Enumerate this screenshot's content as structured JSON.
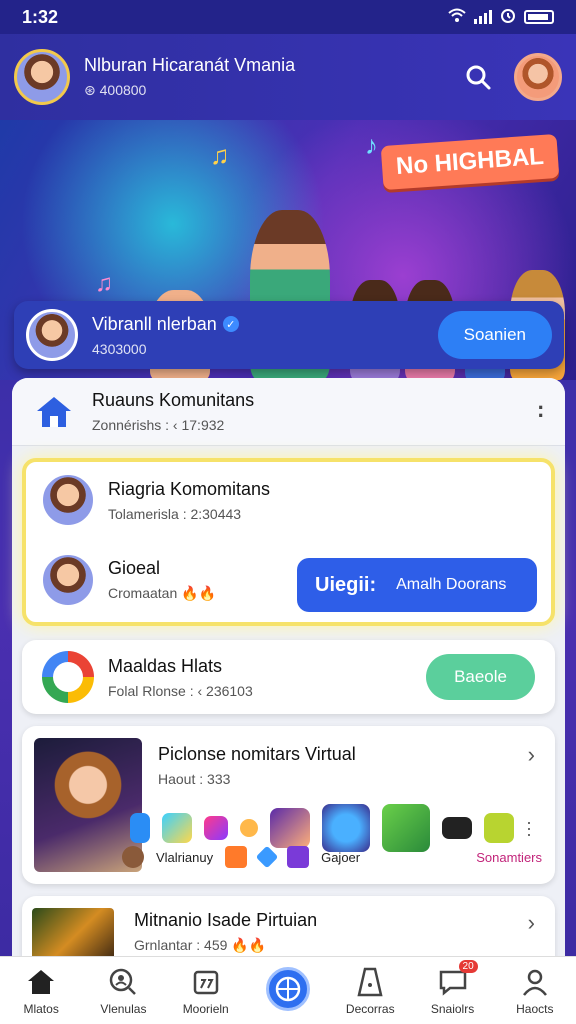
{
  "status_bar": {
    "time": "1:32"
  },
  "header": {
    "name": "Nlburan Hicaranát Vmania",
    "sub": "⊛ 400800"
  },
  "banner": {
    "tag": "No HIGHBAL"
  },
  "profile": {
    "name": "Vibranll nlerban",
    "sub": "4303000",
    "button": "Soanien"
  },
  "list": {
    "community": {
      "title": "Ruauns Komunitans",
      "sub": "Zonnérishs : ‹ 17:932"
    },
    "featured": {
      "title1": "Riagria Komomitans",
      "sub1": "Tolamerisla : 2:30443",
      "title2": "Gioeal",
      "sub2": "Cromaatan 🔥🔥",
      "btn_a": "Uiegii:",
      "btn_b": "Amalh Doorans"
    },
    "maaldas": {
      "title": "Maaldas Hlats",
      "sub": "Folal Rlonse : ‹ 236103",
      "button": "Baeole"
    },
    "virtual": {
      "title": "Piclonse nomitars Virtual",
      "sub": "Haout : 333",
      "foot_left": "Vlalrianuy",
      "foot_mid": "Gajoer",
      "foot_right": "Sonamtiers"
    },
    "mitnanio": {
      "title": "Mitnanio Isade Pirtuian",
      "sub": "Grnlantar : 459 🔥🔥"
    }
  },
  "nav": [
    {
      "label": "Mlatos",
      "icon": "home-icon"
    },
    {
      "label": "Vlenulas",
      "icon": "search-people-icon"
    },
    {
      "label": "Moorieln",
      "icon": "calendar-icon"
    },
    {
      "label": "",
      "icon": "globe-icon"
    },
    {
      "label": "Decorras",
      "icon": "document-icon"
    },
    {
      "label": "Snaiolrs",
      "icon": "chat-icon",
      "badge": "20"
    },
    {
      "label": "Haocts",
      "icon": "profile-icon"
    }
  ],
  "colors": {
    "accent": "#2e6ff0",
    "green": "#5bcf9c",
    "gold": "#f6e26a"
  }
}
